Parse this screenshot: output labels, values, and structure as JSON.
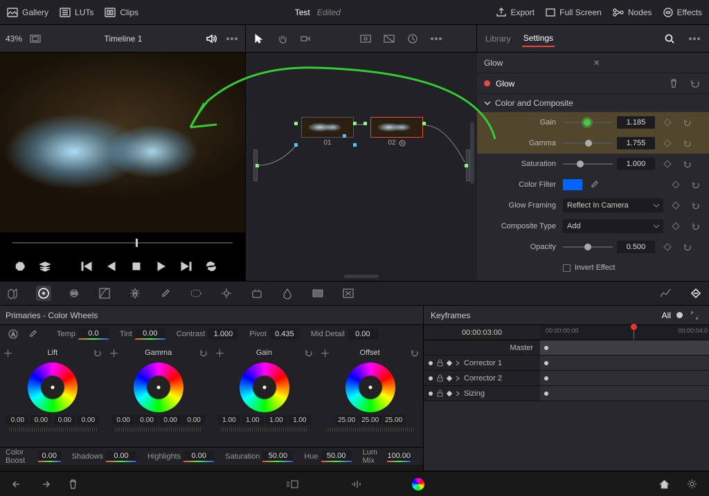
{
  "topbar": {
    "gallery": "Gallery",
    "luts": "LUTs",
    "clips": "Clips",
    "project_name": "Test",
    "project_status": "Edited",
    "export": "Export",
    "fullscreen": "Full Screen",
    "nodes": "Nodes",
    "effects": "Effects"
  },
  "secondbar": {
    "zoom": "43%",
    "timeline": "Timeline 1",
    "tab_library": "Library",
    "tab_settings": "Settings"
  },
  "nodes": {
    "n1": "01",
    "n2": "02"
  },
  "effect": {
    "name": "Glow",
    "title": "Glow",
    "section": "Color and Composite",
    "gain_label": "Gain",
    "gain_value": "1.185",
    "gamma_label": "Gamma",
    "gamma_value": "1.755",
    "saturation_label": "Saturation",
    "saturation_value": "1.000",
    "colorfilter_label": "Color Filter",
    "glowframing_label": "Glow Framing",
    "glowframing_value": "Reflect In Camera",
    "composite_label": "Composite Type",
    "composite_value": "Add",
    "opacity_label": "Opacity",
    "opacity_value": "0.500",
    "invert_label": "Invert Effect"
  },
  "primaries": {
    "title": "Primaries - Color Wheels",
    "temp_l": "Temp",
    "temp_v": "0.0",
    "tint_l": "Tint",
    "tint_v": "0.00",
    "contrast_l": "Contrast",
    "contrast_v": "1.000",
    "pivot_l": "Pivot",
    "pivot_v": "0.435",
    "middetail_l": "Mid Detail",
    "middetail_v": "0.00",
    "wheels": {
      "lift": {
        "name": "Lift",
        "vals": [
          "0.00",
          "0.00",
          "0.00",
          "0.00"
        ]
      },
      "gamma": {
        "name": "Gamma",
        "vals": [
          "0.00",
          "0.00",
          "0.00",
          "0.00"
        ]
      },
      "gain": {
        "name": "Gain",
        "vals": [
          "1.00",
          "1.00",
          "1.00",
          "1.00"
        ]
      },
      "offset": {
        "name": "Offset",
        "vals": [
          "25.00",
          "25.00",
          "25.00"
        ]
      }
    },
    "colorboost_l": "Color Boost",
    "colorboost_v": "0.00",
    "shadows_l": "Shadows",
    "shadows_v": "0.00",
    "highlights_l": "Highlights",
    "highlights_v": "0.00",
    "saturation_l": "Saturation",
    "saturation_v": "50.00",
    "hue_l": "Hue",
    "hue_v": "50.00",
    "lummix_l": "Lum Mix",
    "lummix_v": "100.00"
  },
  "keyframes": {
    "title": "Keyframes",
    "all": "All",
    "tc": "00:00:03:00",
    "ticks": [
      "00:00:00:00",
      "00:00:04:0"
    ],
    "master": "Master",
    "tracks": [
      "Corrector 1",
      "Corrector 2",
      "Sizing"
    ]
  }
}
